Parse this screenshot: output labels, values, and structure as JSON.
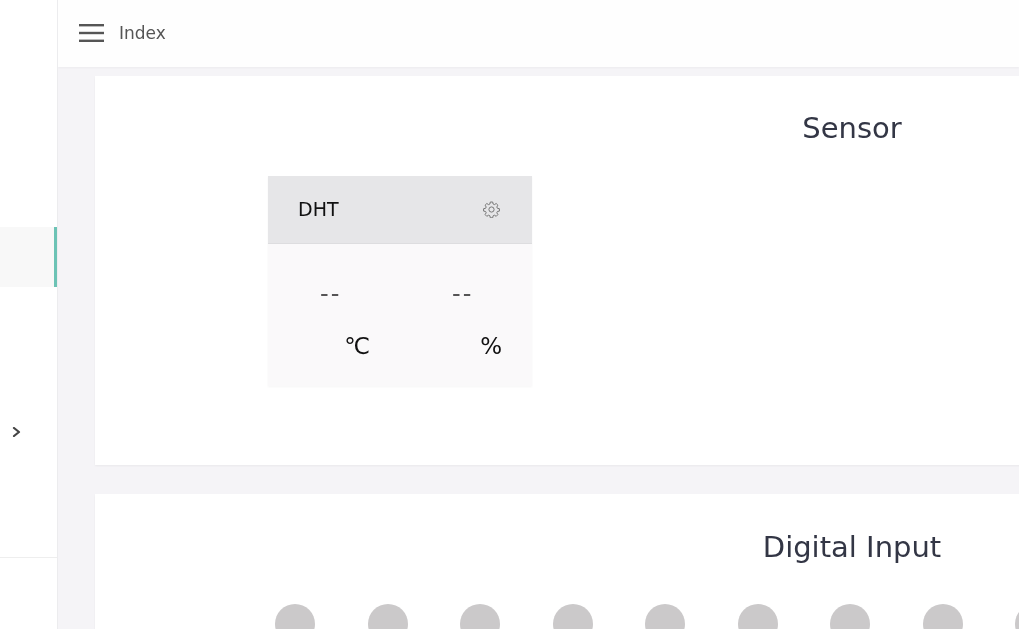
{
  "sidebar": {
    "items": [
      {
        "selected": true
      }
    ]
  },
  "header": {
    "title": "Index"
  },
  "sections": [
    {
      "kind": "sensors",
      "title": "Sensor",
      "sensors": [
        {
          "name": "DHT",
          "readings": [
            {
              "value": "--",
              "unit": "℃"
            },
            {
              "value": "--",
              "unit": "%"
            }
          ]
        }
      ]
    },
    {
      "kind": "digital_inputs",
      "title": "Digital Input",
      "inputs": [
        {
          "on": false
        },
        {
          "on": false
        },
        {
          "on": false
        },
        {
          "on": false
        },
        {
          "on": false
        },
        {
          "on": false
        },
        {
          "on": false
        },
        {
          "on": false
        },
        {
          "on": false
        }
      ]
    }
  ]
}
